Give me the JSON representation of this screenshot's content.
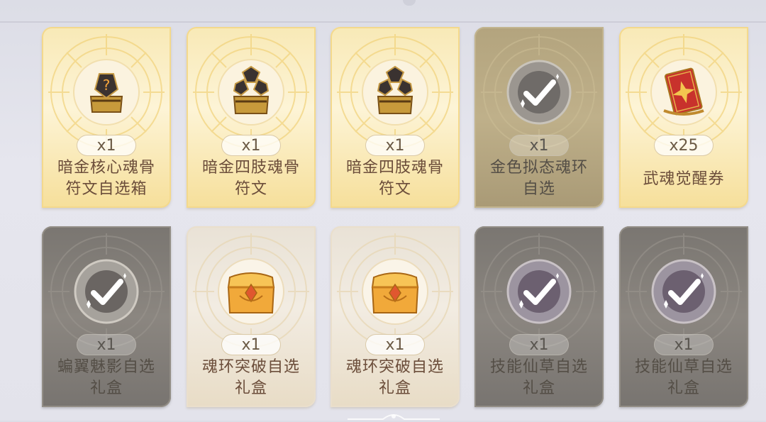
{
  "rows": [
    [
      {
        "count": "x1",
        "name_l1": "暗金核心魂骨",
        "name_l2": "符文自选箱",
        "style": "gold",
        "icon": "dark-gold-rune-box-icon"
      },
      {
        "count": "x1",
        "name_l1": "暗金四肢魂骨",
        "name_l2": "符文",
        "style": "gold",
        "icon": "dark-gold-limb-rune-icon"
      },
      {
        "count": "x1",
        "name_l1": "暗金四肢魂骨",
        "name_l2": "符文",
        "style": "gold",
        "icon": "dark-gold-limb-rune-icon"
      },
      {
        "count": "x1",
        "name_l1": "金色拟态魂环",
        "name_l2": "自选",
        "style": "goldgrey",
        "icon": "selected-checkmark-icon"
      },
      {
        "count": "x25",
        "name_l1": "武魂觉醒券",
        "name_l2": "",
        "style": "gold",
        "icon": "awakening-ticket-icon"
      }
    ],
    [
      {
        "count": "x1",
        "name_l1": "蝙翼魅影自选",
        "name_l2": "礼盒",
        "style": "grey",
        "icon": "selected-checkmark-icon"
      },
      {
        "count": "x1",
        "name_l1": "魂环突破自选",
        "name_l2": "礼盒",
        "style": "pale",
        "icon": "golden-gift-chest-icon"
      },
      {
        "count": "x1",
        "name_l1": "魂环突破自选",
        "name_l2": "礼盒",
        "style": "pale",
        "icon": "golden-gift-chest-icon"
      },
      {
        "count": "x1",
        "name_l1": "技能仙草自选",
        "name_l2": "礼盒",
        "style": "grey",
        "icon": "selected-checkmark-icon"
      },
      {
        "count": "x1",
        "name_l1": "技能仙草自选",
        "name_l2": "礼盒",
        "style": "grey",
        "icon": "selected-checkmark-icon"
      }
    ]
  ]
}
